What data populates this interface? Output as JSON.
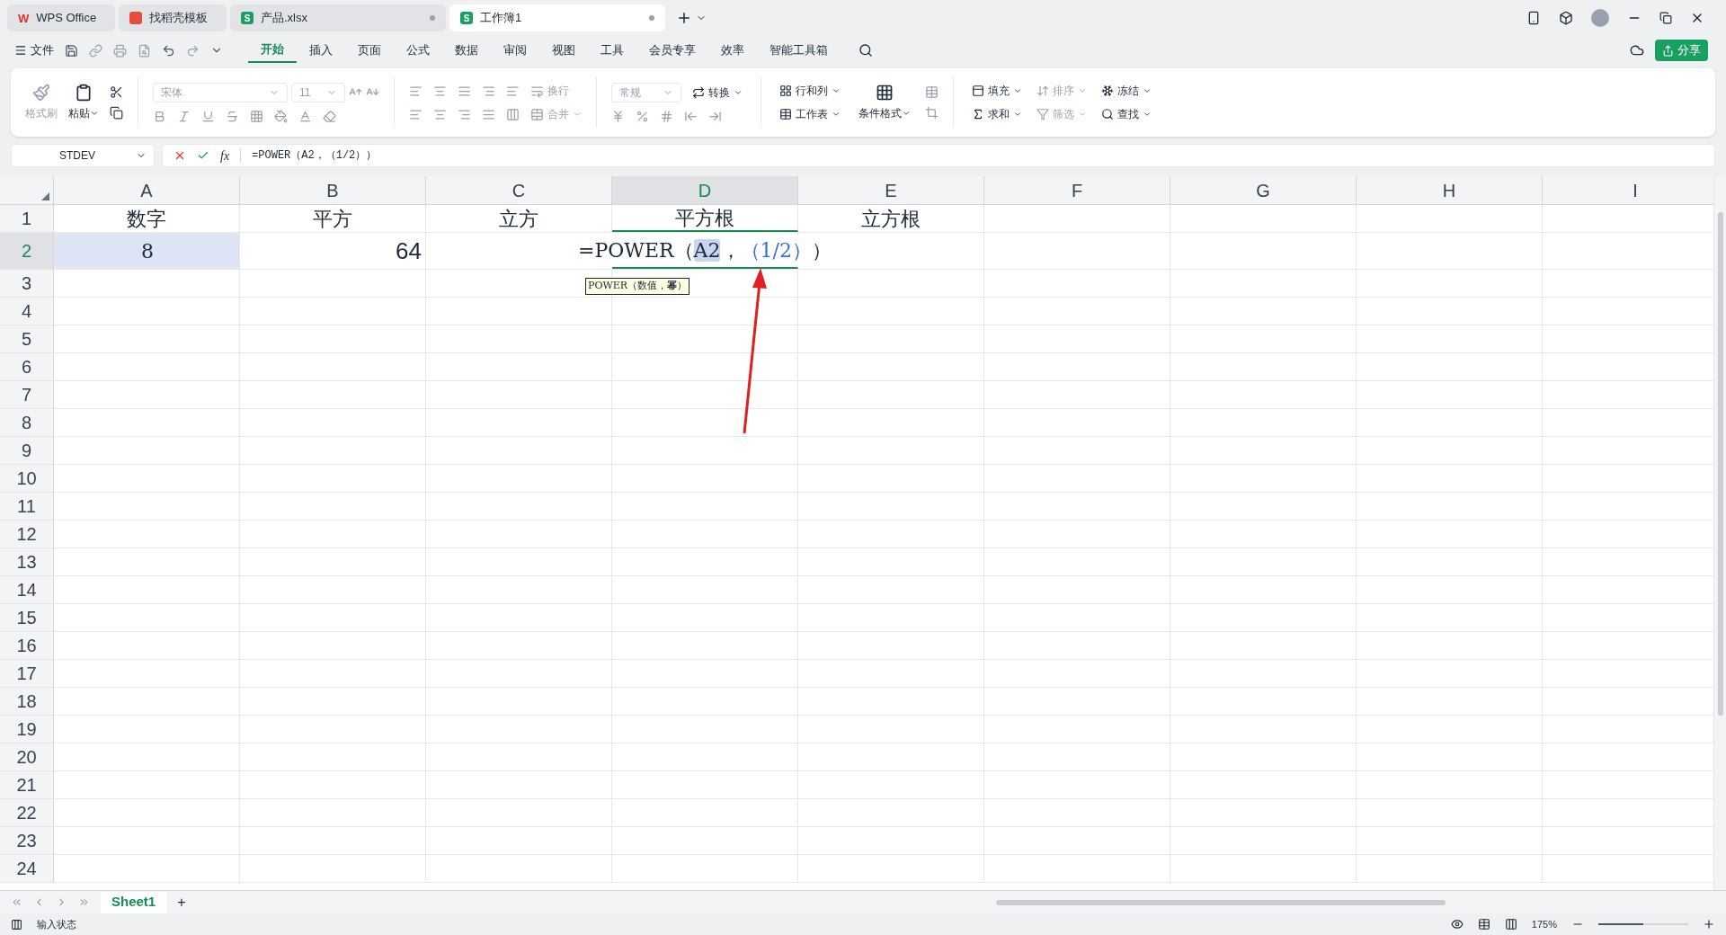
{
  "tabs": [
    {
      "label": "WPS Office",
      "kind": "wps",
      "logo": "W",
      "selected": false
    },
    {
      "label": "找稻壳模板",
      "kind": "template",
      "selected": false
    },
    {
      "label": "产品.xlsx",
      "kind": "sheet",
      "logo": "S",
      "selected": false
    },
    {
      "label": "工作簿1",
      "kind": "sheet",
      "logo": "S",
      "selected": true
    }
  ],
  "file_menu": "文件",
  "menu": [
    {
      "label": "开始",
      "selected": true
    },
    {
      "label": "插入",
      "selected": false
    },
    {
      "label": "页面",
      "selected": false
    },
    {
      "label": "公式",
      "selected": false
    },
    {
      "label": "数据",
      "selected": false
    },
    {
      "label": "审阅",
      "selected": false
    },
    {
      "label": "视图",
      "selected": false
    },
    {
      "label": "工具",
      "selected": false
    },
    {
      "label": "会员专享",
      "selected": false
    },
    {
      "label": "效率",
      "selected": false
    },
    {
      "label": "智能工具箱",
      "selected": false
    }
  ],
  "share": "分享",
  "ribbon": {
    "clipboard": [
      {
        "label": "格式刷",
        "disabled": true
      },
      {
        "label": "粘贴",
        "disabled": false
      }
    ],
    "font_name": "宋体",
    "font_size": "11",
    "wrap": {
      "label": "换行",
      "disabled": true
    },
    "merge": {
      "label": "合并",
      "disabled": true
    },
    "number_format": "常规",
    "convert": "转换",
    "row_col": "行和列",
    "worksheet": "工作表",
    "cond_format": "条件格式",
    "tools": [
      {
        "label": "填充",
        "disabled": false
      },
      {
        "label": "排序",
        "disabled": true
      },
      {
        "label": "冻结",
        "disabled": false
      },
      {
        "label": "求和",
        "disabled": false
      },
      {
        "label": "筛选",
        "disabled": true
      },
      {
        "label": "查找",
        "disabled": false
      }
    ]
  },
  "name_box": "STDEV",
  "function_button": "fx",
  "formula": "=POWER（A2，（1/2））",
  "columns": [
    {
      "label": "A",
      "selected": false
    },
    {
      "label": "B",
      "selected": false
    },
    {
      "label": "C",
      "selected": false
    },
    {
      "label": "D",
      "selected": true
    },
    {
      "label": "E",
      "selected": false
    },
    {
      "label": "F",
      "selected": false
    },
    {
      "label": "G",
      "selected": false
    },
    {
      "label": "H",
      "selected": false
    },
    {
      "label": "I",
      "selected": false
    }
  ],
  "rows": [
    {
      "number": "1",
      "selected": false,
      "cells": [
        "数字",
        "平方",
        "立方",
        "平方根",
        "立方根"
      ]
    },
    {
      "number": "2",
      "selected": true,
      "cells": [
        "8",
        "64"
      ]
    },
    {
      "number": "3",
      "selected": false
    },
    {
      "number": "4",
      "selected": false
    },
    {
      "number": "5",
      "selected": false
    },
    {
      "number": "6",
      "selected": false
    },
    {
      "number": "7",
      "selected": false
    },
    {
      "number": "8",
      "selected": false
    },
    {
      "number": "9",
      "selected": false
    },
    {
      "number": "10",
      "selected": false
    },
    {
      "number": "11",
      "selected": false
    },
    {
      "number": "12",
      "selected": false
    },
    {
      "number": "13",
      "selected": false
    },
    {
      "number": "14",
      "selected": false
    },
    {
      "number": "15",
      "selected": false
    },
    {
      "number": "16",
      "selected": false
    },
    {
      "number": "17",
      "selected": false
    },
    {
      "number": "18",
      "selected": false
    },
    {
      "number": "19",
      "selected": false
    },
    {
      "number": "20",
      "selected": false
    },
    {
      "number": "21",
      "selected": false
    },
    {
      "number": "22",
      "selected": false
    },
    {
      "number": "23",
      "selected": false
    },
    {
      "number": "24",
      "selected": false
    }
  ],
  "editing_cell": {
    "segments": [
      {
        "text": "=POWER（",
        "kind": "plain"
      },
      {
        "text": "A2",
        "kind": "ref"
      },
      {
        "text": "，",
        "kind": "plain"
      },
      {
        "text": "（1/2）",
        "kind": "arg"
      },
      {
        "text": "）",
        "kind": "plain"
      }
    ],
    "tooltip": "POWER（数值，**幂**）"
  },
  "sheets": [
    {
      "label": "Sheet1",
      "selected": true
    }
  ],
  "add_sheet": "+",
  "status": "输入状态",
  "zoom": "175%",
  "zoom_slider": {
    "level": 0.5
  }
}
